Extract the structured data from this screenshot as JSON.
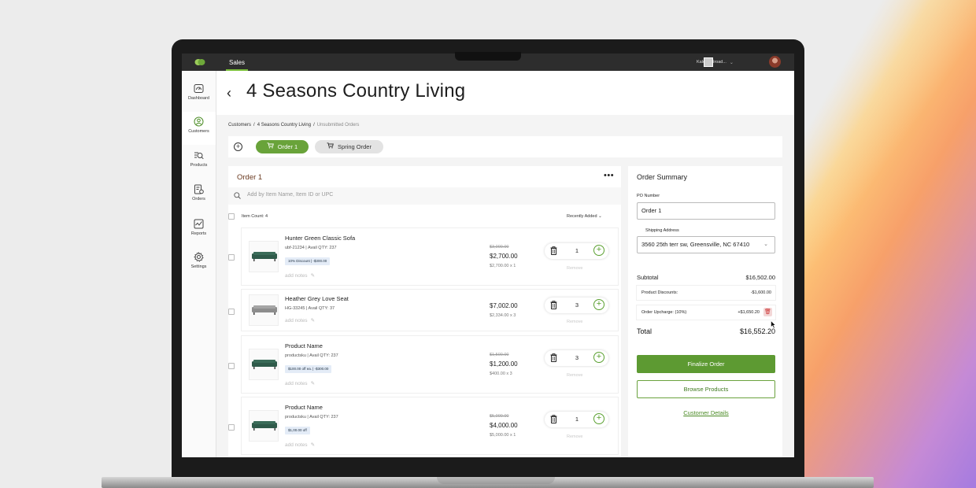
{
  "app": {
    "tab": "Sales",
    "user_name": "Kaleen Broad...",
    "brand_color": "#69a33a"
  },
  "sidebar": {
    "items": [
      {
        "label": "Dashboard",
        "icon": "dashboard-icon"
      },
      {
        "label": "Customers",
        "icon": "customers-icon",
        "active": true
      },
      {
        "label": "Products",
        "icon": "products-icon"
      },
      {
        "label": "Orders",
        "icon": "orders-icon"
      },
      {
        "label": "Reports",
        "icon": "reports-icon"
      },
      {
        "label": "Settings",
        "icon": "settings-icon"
      }
    ]
  },
  "header": {
    "title": "4 Seasons Country Living"
  },
  "breadcrumb": {
    "items": [
      "Customers",
      "4 Seasons Country Living",
      "Unsubmitted Orders"
    ],
    "separator": "/"
  },
  "order_tabs": [
    {
      "label": "Order 1",
      "active": true
    },
    {
      "label": "Spring Order",
      "active": false
    }
  ],
  "order_panel": {
    "title": "Order 1",
    "search_placeholder": "Add by Item Name, Item ID or UPC",
    "item_count": "Item Count: 4",
    "sort": "Recently Added",
    "remove_label": "Remove",
    "notes_label": "add notes",
    "items": [
      {
        "name": "Hunter Green Classic Sofa",
        "sku": "ubf-21234 | Avail QTY: 237",
        "badge": "10% Discount | -$300.00",
        "old_price": "$3,000.00",
        "price": "$2,700.00",
        "unit": "$2,700.00 x 1",
        "qty": "1",
        "color": "green"
      },
      {
        "name": "Heather Grey Love Seat",
        "sku": "HG-33245  | Avail QTY: 37",
        "badge": "",
        "old_price": "",
        "price": "$7,002.00",
        "unit": "$2,334.00 x 3",
        "qty": "3",
        "color": "grey"
      },
      {
        "name": "Product Name",
        "sku": "productsku | Avail QTY: 237",
        "badge": "$100.00 off ea. | -$300.00",
        "old_price": "$1,500.00",
        "price": "$1,200.00",
        "unit": "$400.00 x 3",
        "qty": "3",
        "color": "green"
      },
      {
        "name": "Product Name",
        "sku": "productsku | Avail QTY: 237",
        "badge": "$1,00.00 off",
        "old_price": "$5,000.00",
        "price": "$4,000.00",
        "unit": "$5,000.00 x 1",
        "qty": "1",
        "color": "green"
      }
    ]
  },
  "summary": {
    "title": "Order Summary",
    "po_label": "PO Number",
    "po_value": "Order 1",
    "ship_label": "Shipping Address",
    "ship_value": "3560 25th terr sw, Greensville, NC 67410",
    "subtotal_label": "Subtotal",
    "subtotal_value": "$16,502.00",
    "discount_label": "Product Discounts:",
    "discount_value": "-$1,600.00",
    "upcharge_label": "Order Upcharge: (10%)",
    "upcharge_value": "+$1,650.20",
    "total_label": "Total",
    "total_value": "$16,552.20",
    "finalize_label": "Finalize Order",
    "browse_label": "Browse Products",
    "details_label": "Customer Details"
  }
}
